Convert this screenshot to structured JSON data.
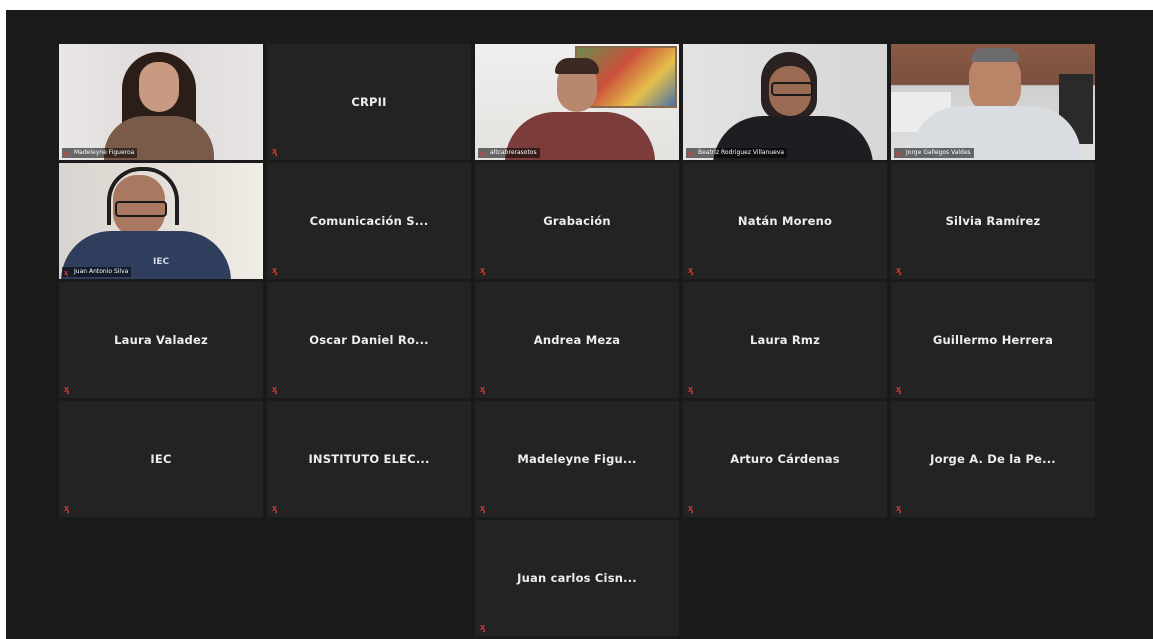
{
  "video_tiles": [
    {
      "id": "p1",
      "label": "Madeleyne Figueroa"
    },
    {
      "id": "p3",
      "label": "altcabrerasotos"
    },
    {
      "id": "p4",
      "label": "Beatriz Rodriguez Villanueva"
    },
    {
      "id": "p5",
      "label": "Jorge Gallegos Valdes"
    },
    {
      "id": "p6",
      "label": "Juan Antonio Silva",
      "logo_text": "IEC"
    }
  ],
  "name_tiles": [
    "CRPII",
    "Comunicación S...",
    "Grabación",
    "Natán Moreno",
    "Silvia Ramírez",
    "Laura Valadez",
    "Oscar Daniel Ro...",
    "Andrea Meza",
    "Laura Rmz",
    "Guillermo Herrera",
    "IEC",
    "INSTITUTO ELEC...",
    "Madeleyne Figu...",
    "Arturo Cárdenas",
    "Jorge A. De la Pe...",
    "Juan carlos Cisn..."
  ],
  "muted_icon": "muted-mic-icon",
  "colors": {
    "background": "#1a1a1a",
    "tile": "#232323",
    "muted": "#e53935",
    "active_speaker": "#b6cf3a"
  }
}
